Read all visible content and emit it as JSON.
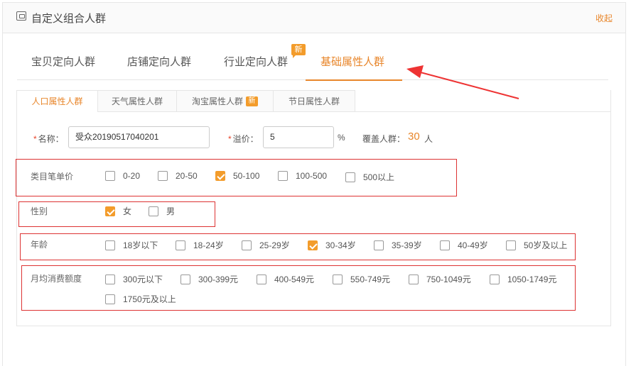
{
  "header": {
    "title": "自定义组合人群",
    "collapse_label": "收起"
  },
  "main_tabs": [
    {
      "label": "宝贝定向人群",
      "active": false
    },
    {
      "label": "店铺定向人群",
      "active": false
    },
    {
      "label": "行业定向人群",
      "active": false
    },
    {
      "label": "基础属性人群",
      "active": true
    }
  ],
  "main_tab_badge": "新",
  "sub_tabs": [
    {
      "label": "人口属性人群",
      "active": true
    },
    {
      "label": "天气属性人群",
      "active": false
    },
    {
      "label": "淘宝属性人群",
      "active": false,
      "badge": "新"
    },
    {
      "label": "节日属性人群",
      "active": false
    }
  ],
  "form": {
    "name_label": "名称：",
    "name_value": "受众20190517040201",
    "premium_label": "溢价：",
    "premium_value": "5",
    "premium_unit": "%",
    "coverage_label": "覆盖人群：",
    "coverage_value": "30",
    "coverage_unit": "人",
    "required_mark": "*"
  },
  "groups": [
    {
      "label": "类目笔单价",
      "options": [
        {
          "label": "0-20",
          "checked": false
        },
        {
          "label": "20-50",
          "checked": false
        },
        {
          "label": "50-100",
          "checked": true
        },
        {
          "label": "100-500",
          "checked": false
        },
        {
          "label": "500以上",
          "checked": false
        }
      ]
    },
    {
      "label": "性别",
      "options": [
        {
          "label": "女",
          "checked": true
        },
        {
          "label": "男",
          "checked": false
        }
      ]
    },
    {
      "label": "年龄",
      "options": [
        {
          "label": "18岁以下",
          "checked": false
        },
        {
          "label": "18-24岁",
          "checked": false
        },
        {
          "label": "25-29岁",
          "checked": false
        },
        {
          "label": "30-34岁",
          "checked": true
        },
        {
          "label": "35-39岁",
          "checked": false
        },
        {
          "label": "40-49岁",
          "checked": false
        },
        {
          "label": "50岁及以上",
          "checked": false
        }
      ]
    },
    {
      "label": "月均消费额度",
      "options": [
        {
          "label": "300元以下",
          "checked": false
        },
        {
          "label": "300-399元",
          "checked": false
        },
        {
          "label": "400-549元",
          "checked": false
        },
        {
          "label": "550-749元",
          "checked": false
        },
        {
          "label": "750-1049元",
          "checked": false
        },
        {
          "label": "1050-1749元",
          "checked": false
        },
        {
          "label": "1750元及以上",
          "checked": false
        }
      ]
    }
  ],
  "colors": {
    "accent": "#e8862b",
    "badge": "#f39c2b",
    "highlight_box": "#dd3333"
  }
}
